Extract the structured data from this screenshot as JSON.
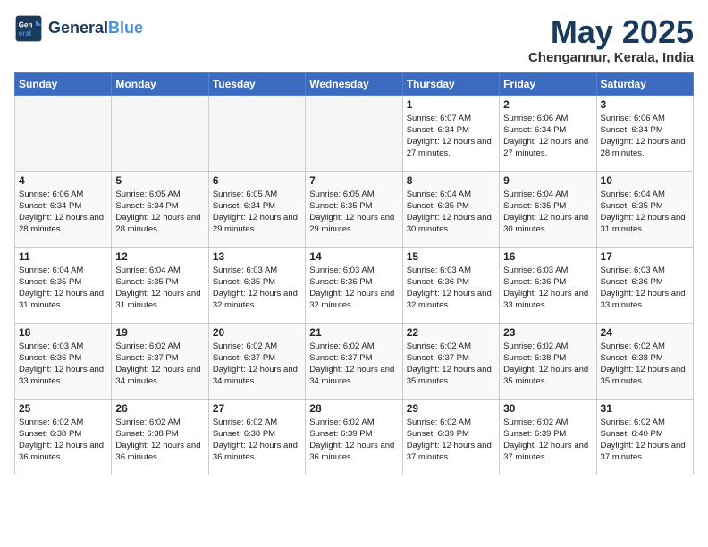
{
  "header": {
    "logo_line1": "General",
    "logo_line2": "Blue",
    "month_title": "May 2025",
    "location": "Chengannur, Kerala, India"
  },
  "weekdays": [
    "Sunday",
    "Monday",
    "Tuesday",
    "Wednesday",
    "Thursday",
    "Friday",
    "Saturday"
  ],
  "weeks": [
    [
      {
        "day": "",
        "empty": true
      },
      {
        "day": "",
        "empty": true
      },
      {
        "day": "",
        "empty": true
      },
      {
        "day": "",
        "empty": true
      },
      {
        "day": "1",
        "sunrise": "6:07 AM",
        "sunset": "6:34 PM",
        "daylight": "12 hours and 27 minutes."
      },
      {
        "day": "2",
        "sunrise": "6:06 AM",
        "sunset": "6:34 PM",
        "daylight": "12 hours and 27 minutes."
      },
      {
        "day": "3",
        "sunrise": "6:06 AM",
        "sunset": "6:34 PM",
        "daylight": "12 hours and 28 minutes."
      }
    ],
    [
      {
        "day": "4",
        "sunrise": "6:06 AM",
        "sunset": "6:34 PM",
        "daylight": "12 hours and 28 minutes."
      },
      {
        "day": "5",
        "sunrise": "6:05 AM",
        "sunset": "6:34 PM",
        "daylight": "12 hours and 28 minutes."
      },
      {
        "day": "6",
        "sunrise": "6:05 AM",
        "sunset": "6:34 PM",
        "daylight": "12 hours and 29 minutes."
      },
      {
        "day": "7",
        "sunrise": "6:05 AM",
        "sunset": "6:35 PM",
        "daylight": "12 hours and 29 minutes."
      },
      {
        "day": "8",
        "sunrise": "6:04 AM",
        "sunset": "6:35 PM",
        "daylight": "12 hours and 30 minutes."
      },
      {
        "day": "9",
        "sunrise": "6:04 AM",
        "sunset": "6:35 PM",
        "daylight": "12 hours and 30 minutes."
      },
      {
        "day": "10",
        "sunrise": "6:04 AM",
        "sunset": "6:35 PM",
        "daylight": "12 hours and 31 minutes."
      }
    ],
    [
      {
        "day": "11",
        "sunrise": "6:04 AM",
        "sunset": "6:35 PM",
        "daylight": "12 hours and 31 minutes."
      },
      {
        "day": "12",
        "sunrise": "6:04 AM",
        "sunset": "6:35 PM",
        "daylight": "12 hours and 31 minutes."
      },
      {
        "day": "13",
        "sunrise": "6:03 AM",
        "sunset": "6:35 PM",
        "daylight": "12 hours and 32 minutes."
      },
      {
        "day": "14",
        "sunrise": "6:03 AM",
        "sunset": "6:36 PM",
        "daylight": "12 hours and 32 minutes."
      },
      {
        "day": "15",
        "sunrise": "6:03 AM",
        "sunset": "6:36 PM",
        "daylight": "12 hours and 32 minutes."
      },
      {
        "day": "16",
        "sunrise": "6:03 AM",
        "sunset": "6:36 PM",
        "daylight": "12 hours and 33 minutes."
      },
      {
        "day": "17",
        "sunrise": "6:03 AM",
        "sunset": "6:36 PM",
        "daylight": "12 hours and 33 minutes."
      }
    ],
    [
      {
        "day": "18",
        "sunrise": "6:03 AM",
        "sunset": "6:36 PM",
        "daylight": "12 hours and 33 minutes."
      },
      {
        "day": "19",
        "sunrise": "6:02 AM",
        "sunset": "6:37 PM",
        "daylight": "12 hours and 34 minutes."
      },
      {
        "day": "20",
        "sunrise": "6:02 AM",
        "sunset": "6:37 PM",
        "daylight": "12 hours and 34 minutes."
      },
      {
        "day": "21",
        "sunrise": "6:02 AM",
        "sunset": "6:37 PM",
        "daylight": "12 hours and 34 minutes."
      },
      {
        "day": "22",
        "sunrise": "6:02 AM",
        "sunset": "6:37 PM",
        "daylight": "12 hours and 35 minutes."
      },
      {
        "day": "23",
        "sunrise": "6:02 AM",
        "sunset": "6:38 PM",
        "daylight": "12 hours and 35 minutes."
      },
      {
        "day": "24",
        "sunrise": "6:02 AM",
        "sunset": "6:38 PM",
        "daylight": "12 hours and 35 minutes."
      }
    ],
    [
      {
        "day": "25",
        "sunrise": "6:02 AM",
        "sunset": "6:38 PM",
        "daylight": "12 hours and 36 minutes."
      },
      {
        "day": "26",
        "sunrise": "6:02 AM",
        "sunset": "6:38 PM",
        "daylight": "12 hours and 36 minutes."
      },
      {
        "day": "27",
        "sunrise": "6:02 AM",
        "sunset": "6:38 PM",
        "daylight": "12 hours and 36 minutes."
      },
      {
        "day": "28",
        "sunrise": "6:02 AM",
        "sunset": "6:39 PM",
        "daylight": "12 hours and 36 minutes."
      },
      {
        "day": "29",
        "sunrise": "6:02 AM",
        "sunset": "6:39 PM",
        "daylight": "12 hours and 37 minutes."
      },
      {
        "day": "30",
        "sunrise": "6:02 AM",
        "sunset": "6:39 PM",
        "daylight": "12 hours and 37 minutes."
      },
      {
        "day": "31",
        "sunrise": "6:02 AM",
        "sunset": "6:40 PM",
        "daylight": "12 hours and 37 minutes."
      }
    ]
  ]
}
